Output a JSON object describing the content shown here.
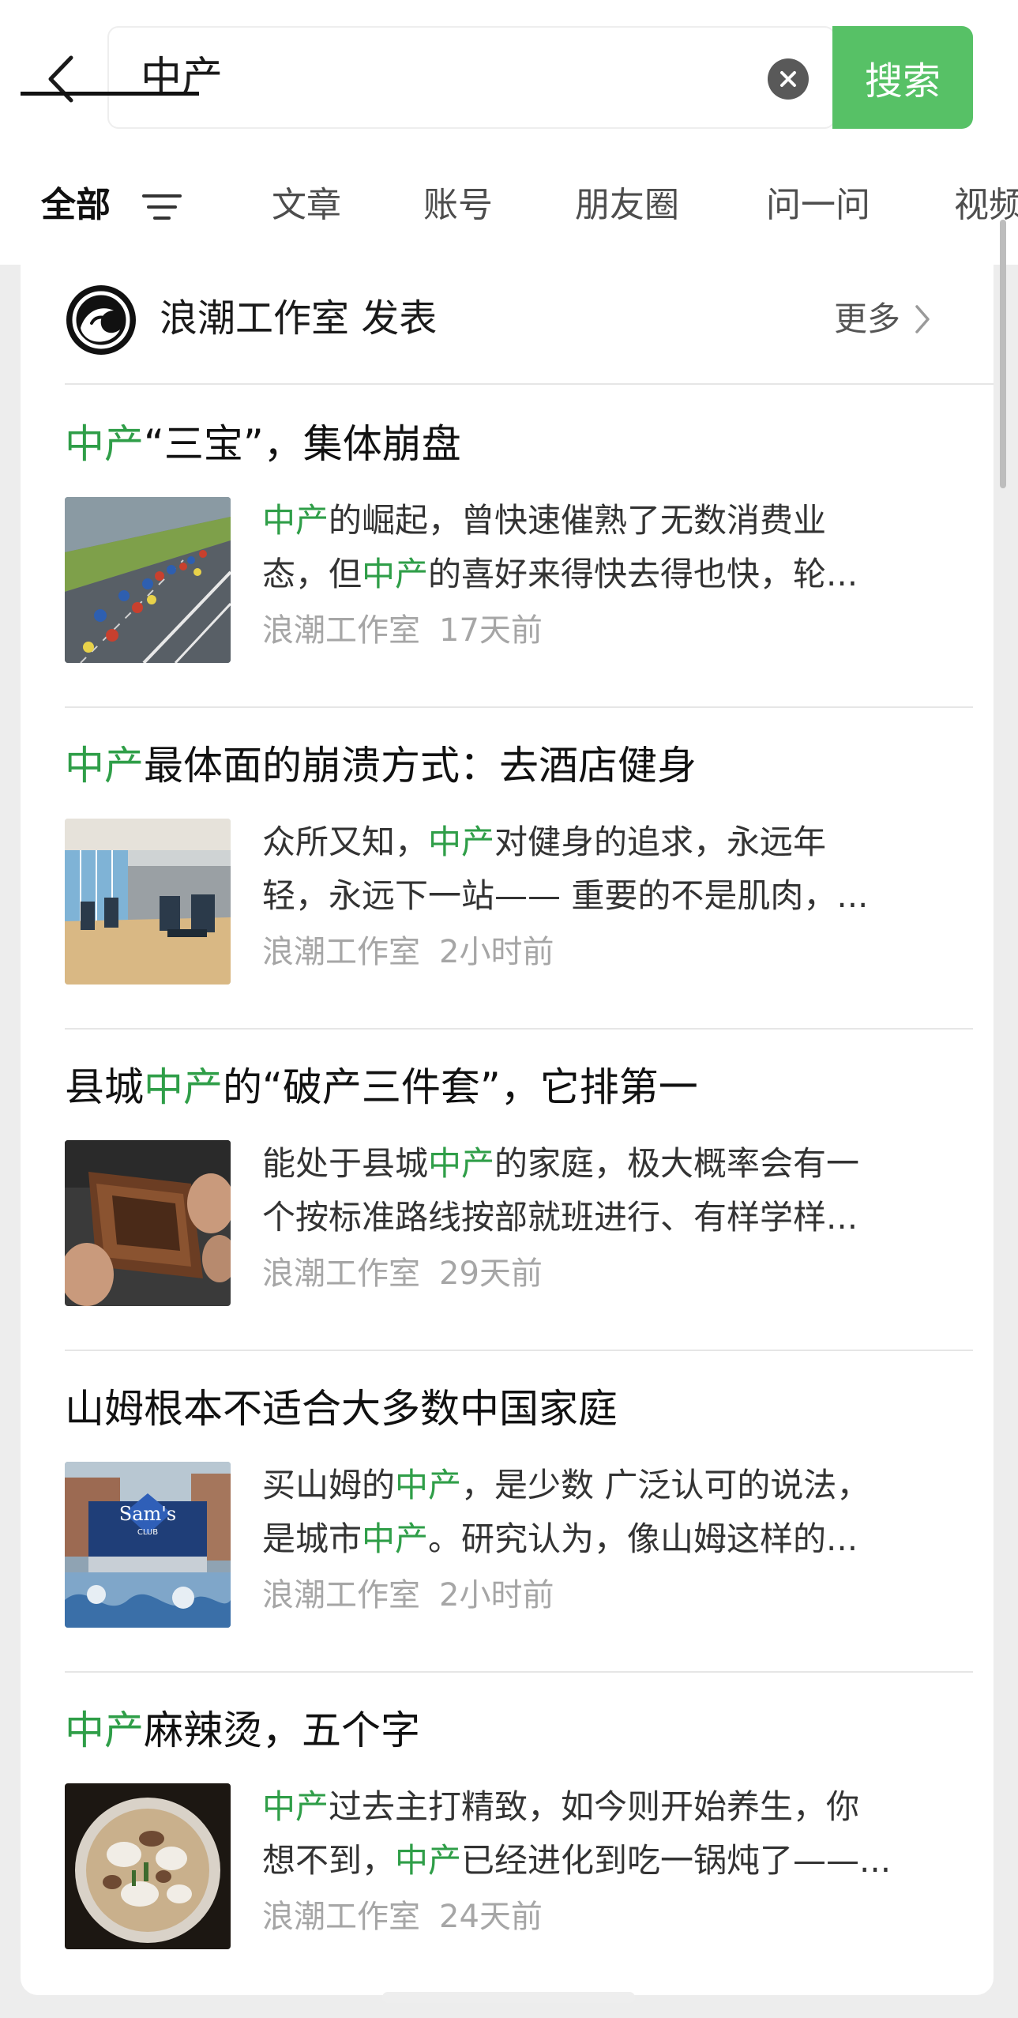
{
  "search": {
    "query": "中产",
    "button_label": "搜索"
  },
  "tabs": [
    {
      "label": "全部",
      "active": true
    },
    {
      "label": "文章"
    },
    {
      "label": "账号"
    },
    {
      "label": "朋友圈"
    },
    {
      "label": "问一问"
    },
    {
      "label": "视频"
    }
  ],
  "source": {
    "title": "浪潮工作室 发表",
    "more_label": "更多"
  },
  "articles": [
    {
      "title": [
        {
          "t": "中产",
          "hl": true
        },
        {
          "t": "“三宝”，集体崩盘"
        }
      ],
      "snippet_lines": [
        [
          {
            "t": "中产",
            "hl": true
          },
          {
            "t": "的崛起，曾快速催熟了无数消费业"
          }
        ],
        [
          {
            "t": "态，但"
          },
          {
            "t": "中产",
            "hl": true
          },
          {
            "t": "的喜好来得快去得也快，轮..."
          }
        ]
      ],
      "author": "浪潮工作室",
      "time": "17天前",
      "thumbnail": "cycling-race-photo"
    },
    {
      "title": [
        {
          "t": "中产",
          "hl": true
        },
        {
          "t": "最体面的崩溃方式：去酒店健身"
        }
      ],
      "snippet_lines": [
        [
          {
            "t": "众所又知，"
          },
          {
            "t": "中产",
            "hl": true
          },
          {
            "t": "对健身的追求，永远年"
          }
        ],
        [
          {
            "t": "轻，永远下一站—— 重要的不是肌肉，..."
          }
        ]
      ],
      "author": "浪潮工作室",
      "time": "2小时前",
      "thumbnail": "hotel-gym-photo"
    },
    {
      "title": [
        {
          "t": "县城"
        },
        {
          "t": "中产",
          "hl": true
        },
        {
          "t": "的“破产三件套”，它排第一"
        }
      ],
      "snippet_lines": [
        [
          {
            "t": "能处于县城"
          },
          {
            "t": "中产",
            "hl": true
          },
          {
            "t": "的家庭，极大概率会有一"
          }
        ],
        [
          {
            "t": "个按标准路线按部就班进行、有样学样..."
          }
        ]
      ],
      "author": "浪潮工作室",
      "time": "29天前",
      "thumbnail": "empty-wallet-photo"
    },
    {
      "title": [
        {
          "t": "山姆根本不适合大多数中国家庭"
        }
      ],
      "snippet_lines": [
        [
          {
            "t": "买山姆的"
          },
          {
            "t": "中产",
            "hl": true
          },
          {
            "t": "，是少数 广泛认可的说法，"
          }
        ],
        [
          {
            "t": "是城市"
          },
          {
            "t": "中产",
            "hl": true
          },
          {
            "t": "。研究认为，像山姆这样的..."
          }
        ]
      ],
      "author": "浪潮工作室",
      "time": "2小时前",
      "thumbnail": "sams-club-store-photo",
      "thumb_sign": "Sam's",
      "thumb_sign_sub": "CLUB"
    },
    {
      "title": [
        {
          "t": "中产",
          "hl": true
        },
        {
          "t": "麻辣烫，五个字"
        }
      ],
      "snippet_lines": [
        [
          {
            "t": "中产",
            "hl": true
          },
          {
            "t": "过去主打精致，如今则开始养生，你"
          }
        ],
        [
          {
            "t": "想不到，"
          },
          {
            "t": "中产",
            "hl": true
          },
          {
            "t": "已经进化到吃一锅炖了——..."
          }
        ]
      ],
      "author": "浪潮工作室",
      "time": "24天前",
      "thumbnail": "hotpot-bowl-photo"
    }
  ],
  "colors": {
    "accent_green": "#57c166",
    "highlight_green": "#2f9e48",
    "background": "#ededed"
  }
}
